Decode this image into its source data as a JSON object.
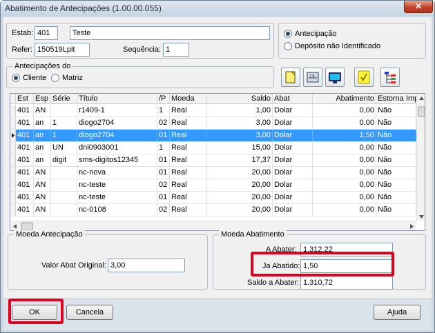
{
  "window": {
    "title": "Abatimento de Antecipações (1.00.00.055)",
    "close_glyph": "✕"
  },
  "header": {
    "estab_label": "Estab:",
    "estab_value": "401",
    "name_value": "Teste",
    "refer_label": "Refer:",
    "refer_value": "150519Lpit",
    "sequencia_label": "Sequência:",
    "sequencia_value": "1"
  },
  "tipo": {
    "options": [
      "Antecipação",
      "Depósito não Identificado"
    ],
    "selected": 0
  },
  "antecipacoes_do": {
    "legend": "Antecipações do",
    "options": [
      "Cliente",
      "Matriz"
    ],
    "selected": 0
  },
  "toolbar": {
    "icons": [
      "new-document-icon",
      "calculator-icon",
      "monitor-icon",
      "checkmark-icon",
      "tree-structure-icon"
    ]
  },
  "grid": {
    "columns": [
      "Est",
      "Esp",
      "Série",
      "Título",
      "/P",
      "Moeda",
      "Saldo",
      "Abat",
      "Abatimento",
      "Estorna Impl"
    ],
    "rows": [
      [
        "401",
        "AN",
        "",
        "r1409-1",
        "1",
        "Real",
        "1,00",
        "Dolar",
        "0,00",
        "Não"
      ],
      [
        "401",
        "an",
        "1",
        "diogo2704",
        "02",
        "Real",
        "3,00",
        "Dolar",
        "0,00",
        "Não"
      ],
      [
        "401",
        "an",
        "1",
        "diogo2704",
        "01",
        "Real",
        "3,00",
        "Dolar",
        "1,50",
        "Não"
      ],
      [
        "401",
        "an",
        "UN",
        "dni0903001",
        "1",
        "Real",
        "15,00",
        "Dolar",
        "0,00",
        "Não"
      ],
      [
        "401",
        "an",
        "digit",
        "sms-digitos12345",
        "01",
        "Real",
        "17,37",
        "Dolar",
        "0,00",
        "Não"
      ],
      [
        "401",
        "AN",
        "",
        "nc-nova",
        "01",
        "Real",
        "20,00",
        "Dolar",
        "0,00",
        "Não"
      ],
      [
        "401",
        "AN",
        "",
        "nc-teste",
        "02",
        "Real",
        "20,00",
        "Dolar",
        "0,00",
        "Não"
      ],
      [
        "401",
        "AN",
        "",
        "nc-teste",
        "01",
        "Real",
        "20,00",
        "Dolar",
        "0,00",
        "Não"
      ],
      [
        "401",
        "AN",
        "",
        "nc-0108",
        "02",
        "Real",
        "20,00",
        "Dolar",
        "0,00",
        "Não"
      ]
    ],
    "selected_row": 2
  },
  "moeda_antecipacao": {
    "legend": "Moeda Antecipação",
    "valor_label": "Valor Abat Original:",
    "valor_value": "3,00"
  },
  "moeda_abatimento": {
    "legend": "Moeda Abatimento",
    "a_abater_label": "A Abater:",
    "a_abater_value": "1.312,22",
    "ja_abatido_label": "Ja Abatido:",
    "ja_abatido_value": "1,50",
    "saldo_label": "Saldo a Abater:",
    "saldo_value": "1.310,72"
  },
  "buttons": {
    "ok": "OK",
    "cancela": "Cancela",
    "ajuda": "Ajuda"
  },
  "colors": {
    "selection": "#3399ff",
    "highlight": "#e0001b",
    "frame": "#cfd9e4"
  }
}
